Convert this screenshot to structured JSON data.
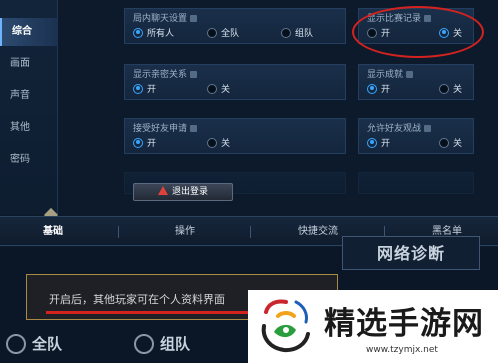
{
  "sidebar": {
    "items": [
      {
        "label": "综合",
        "active": true
      },
      {
        "label": "画面"
      },
      {
        "label": "声音"
      },
      {
        "label": "其他"
      },
      {
        "label": "密码"
      }
    ]
  },
  "settings": {
    "chat_in_game": {
      "title": "局内聊天设置",
      "options": [
        "所有人",
        "全队",
        "组队"
      ],
      "selected": "所有人"
    },
    "show_match_record": {
      "title": "显示比赛记录",
      "options": [
        "开",
        "关"
      ],
      "selected": "关"
    },
    "show_intimacy": {
      "title": "显示亲密关系",
      "options": [
        "开",
        "关"
      ],
      "selected": "开"
    },
    "show_achievement": {
      "title": "显示成就",
      "options": [
        "开",
        "关"
      ],
      "selected": "开"
    },
    "accept_friend_request": {
      "title": "接受好友申请",
      "options": [
        "开",
        "关"
      ],
      "selected": "开"
    },
    "allow_friend_spectate": {
      "title": "允许好友观战",
      "options": [
        "开",
        "关"
      ],
      "selected": "开"
    }
  },
  "logout": {
    "label": "退出登录"
  },
  "tabs": [
    {
      "label": "基础",
      "active": true
    },
    {
      "label": "操作"
    },
    {
      "label": "快捷交流"
    },
    {
      "label": "黑名单"
    }
  ],
  "network_diag": {
    "label": "网络诊断"
  },
  "tooltip": {
    "text": "开启后，其他玩家可在个人资料界面"
  },
  "zoom_options": [
    "全队",
    "组队"
  ],
  "watermark": {
    "title": "精选手游网",
    "url": "www.tzymjx.net"
  },
  "colors": {
    "accent": "#38a6ff",
    "highlight_red": "#d4221f",
    "background": "#0c1a2b"
  }
}
